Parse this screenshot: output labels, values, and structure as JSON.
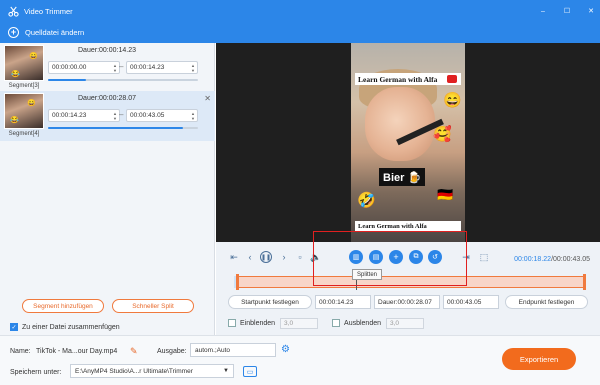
{
  "window": {
    "title": "Video Trimmer",
    "controls": [
      "–",
      "☐",
      "✕"
    ]
  },
  "toolbar": {
    "add_source_label": "Quelldatei ändern"
  },
  "segments": [
    {
      "label": "Segment[3]",
      "duration": "Dauer:00:00:14.23",
      "start": "00:00:00.00",
      "end": "00:00:14.23",
      "progress": 0.25
    },
    {
      "label": "Segment[4]",
      "duration": "Dauer:00:00:28.07",
      "start": "00:00:14.23",
      "end": "00:00:43.05",
      "progress": 0.9
    }
  ],
  "left_buttons": {
    "add_segment": "Segment hinzufügen",
    "fast_split": "Schneller Split"
  },
  "merge": {
    "label": "Zu einer Datei zusammenfügen",
    "checked": true
  },
  "video": {
    "banner_top": "Learn German with Alfa",
    "banner_bottom": "Learn German with Alfa",
    "bier_text": "Bier 🍺"
  },
  "player": {
    "current_time": "00:00:18.22",
    "total_time": "/00:00:43.05",
    "tooltip": "Splitten"
  },
  "set_row": {
    "start_button": "Startpunkt festlegen",
    "start_value": "00:00:14.23",
    "duration_value": "Dauer:00:00:28.07",
    "end_value": "00:00:43.05",
    "end_button": "Endpunkt festlegen"
  },
  "fade": {
    "fade_in_label": "Einblenden",
    "fade_in_value": "3,0",
    "fade_out_label": "Ausblenden",
    "fade_out_value": "3,0"
  },
  "bottom": {
    "name_label": "Name:",
    "name_value": "TikTok - Ma...our Day.mp4",
    "output_label": "Ausgabe:",
    "output_value": "autom.;Auto",
    "save_label": "Speichern unter:",
    "save_path": "E:\\AnyMP4 Studio\\A...r Ultimate\\Trimmer",
    "export_label": "Exportieren"
  },
  "colors": {
    "accent": "#2c86e8",
    "orange": "#f26b1d",
    "highlight": "#e02020"
  }
}
